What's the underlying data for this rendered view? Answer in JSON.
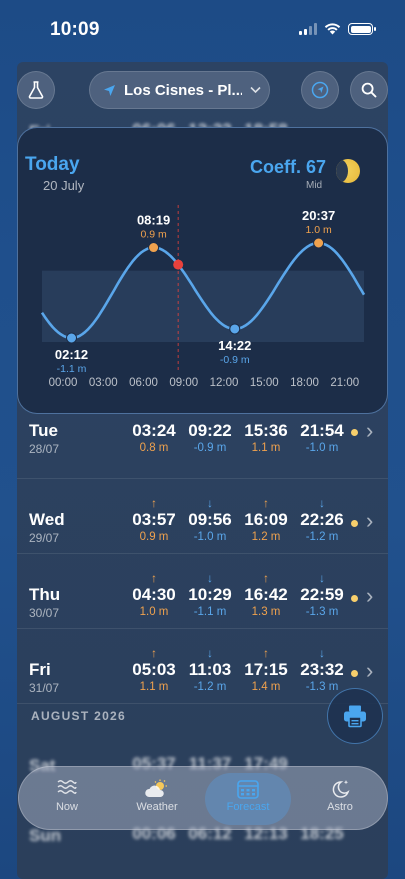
{
  "status": {
    "time": "10:09"
  },
  "header": {
    "location": "Los Cisnes - Pl...",
    "lab_icon": "flask-icon",
    "nav_icon": "navigation-icon",
    "search_icon": "search-icon"
  },
  "today": {
    "title": "Today",
    "date": "20 July",
    "coefficient": "Coeff. 67",
    "coefficient_level": "Mid",
    "extremes": [
      {
        "type": "low",
        "time": "02:12",
        "height": "-1.1 m"
      },
      {
        "type": "high",
        "time": "08:19",
        "height": "0.9 m"
      },
      {
        "type": "low",
        "time": "14:22",
        "height": "-0.9 m"
      },
      {
        "type": "high",
        "time": "20:37",
        "height": "1.0 m"
      }
    ],
    "hour_ticks": [
      "00:00",
      "03:00",
      "06:00",
      "09:00",
      "12:00",
      "15:00",
      "18:00",
      "21:00"
    ]
  },
  "top_partial_rows": [
    {
      "day": "Fri",
      "date": "",
      "times": [
        "06:06",
        "12:22",
        "18:58"
      ]
    }
  ],
  "rows": [
    {
      "day": "Tue",
      "date": "28/07",
      "tides": [
        {
          "type": "high",
          "time": "03:24",
          "height": "0.8 m"
        },
        {
          "type": "low",
          "time": "09:22",
          "height": "-0.9 m"
        },
        {
          "type": "high",
          "time": "15:36",
          "height": "1.1 m"
        },
        {
          "type": "low",
          "time": "21:54",
          "height": "-1.0 m"
        }
      ]
    },
    {
      "day": "Wed",
      "date": "29/07",
      "tides": [
        {
          "type": "high",
          "time": "03:57",
          "height": "0.9 m"
        },
        {
          "type": "low",
          "time": "09:56",
          "height": "-1.0 m"
        },
        {
          "type": "high",
          "time": "16:09",
          "height": "1.2 m"
        },
        {
          "type": "low",
          "time": "22:26",
          "height": "-1.2 m"
        }
      ]
    },
    {
      "day": "Thu",
      "date": "30/07",
      "tides": [
        {
          "type": "high",
          "time": "04:30",
          "height": "1.0 m"
        },
        {
          "type": "low",
          "time": "10:29",
          "height": "-1.1 m"
        },
        {
          "type": "high",
          "time": "16:42",
          "height": "1.3 m"
        },
        {
          "type": "low",
          "time": "22:59",
          "height": "-1.3 m"
        }
      ]
    },
    {
      "day": "Fri",
      "date": "31/07",
      "tides": [
        {
          "type": "high",
          "time": "05:03",
          "height": "1.1 m"
        },
        {
          "type": "low",
          "time": "11:03",
          "height": "-1.2 m"
        },
        {
          "type": "high",
          "time": "17:15",
          "height": "1.4 m"
        },
        {
          "type": "low",
          "time": "23:32",
          "height": "-1.3 m"
        }
      ]
    }
  ],
  "section": {
    "label": "AUGUST 2026"
  },
  "bottom_rows": [
    {
      "day": "Sat",
      "times": [
        "05:37",
        "11:37",
        "17:49"
      ]
    },
    {
      "day": "Sun",
      "times": [
        "00:06",
        "06:12",
        "12:13",
        "18:25"
      ]
    }
  ],
  "tabs": [
    {
      "label": "Now",
      "icon": "waves-icon"
    },
    {
      "label": "Weather",
      "icon": "cloud-sun-icon"
    },
    {
      "label": "Forecast",
      "icon": "calendar-icon"
    },
    {
      "label": "Astro",
      "icon": "moon-stars-icon"
    }
  ],
  "colors": {
    "accent": "#4aa6ef",
    "high": "#f0a24e",
    "low": "#5aa6ea",
    "now_marker": "#e8413c"
  }
}
